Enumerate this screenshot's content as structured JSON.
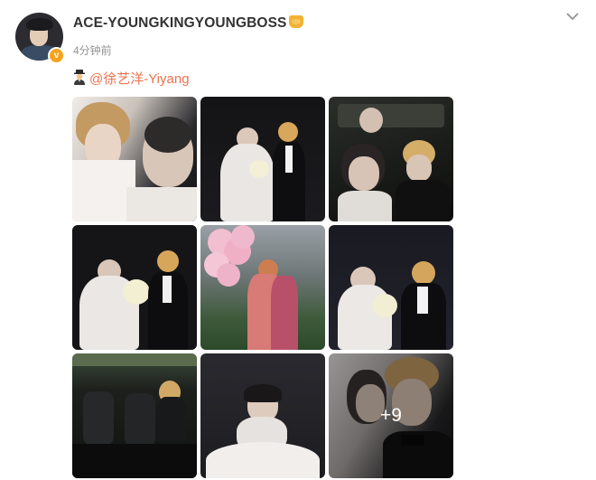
{
  "post": {
    "username": "ACE-YOUNGKINGYOUNGBOSS",
    "timestamp": "4分钟前",
    "mention": "@徐艺洋-Yiyang",
    "more_count": "+9",
    "photos": [
      {
        "desc": "couple-closeup"
      },
      {
        "desc": "couple-standing-wedding"
      },
      {
        "desc": "couple-theater-seats"
      },
      {
        "desc": "couple-bouquet"
      },
      {
        "desc": "couple-pink-balloons"
      },
      {
        "desc": "couple-portrait"
      },
      {
        "desc": "car-interior"
      },
      {
        "desc": "bride-solo"
      },
      {
        "desc": "couple-closeup-more"
      }
    ]
  },
  "colors": {
    "link": "#eb7350",
    "username": "#333333",
    "timestamp": "#939393",
    "verified": "#f7a21b"
  }
}
